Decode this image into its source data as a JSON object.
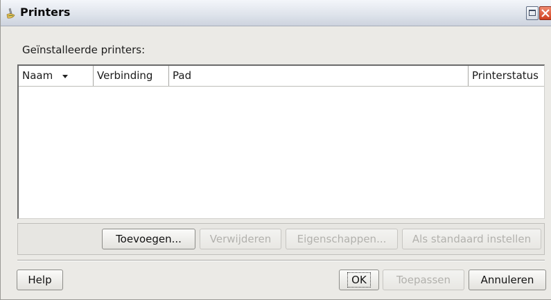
{
  "window": {
    "title": "Printers",
    "icon": "printer-brush-icon"
  },
  "list": {
    "label": "Geïnstalleerde printers:",
    "columns": [
      {
        "label": "Naam",
        "sorted": true,
        "sort_icon": "sort-descending-icon"
      },
      {
        "label": "Verbinding"
      },
      {
        "label": "Pad"
      },
      {
        "label": "Printerstatus"
      }
    ],
    "rows": []
  },
  "actions": {
    "add": "Toevoegen...",
    "remove": "Verwijderen",
    "properties": "Eigenschappen...",
    "set_default": "Als standaard instellen"
  },
  "footer": {
    "help": "Help",
    "ok": "OK",
    "apply": "Toepassen",
    "cancel": "Annuleren"
  },
  "colors": {
    "titlebar": "#dfe4ec",
    "window_bg": "#ebeae6",
    "close_button": "#d0401e"
  }
}
